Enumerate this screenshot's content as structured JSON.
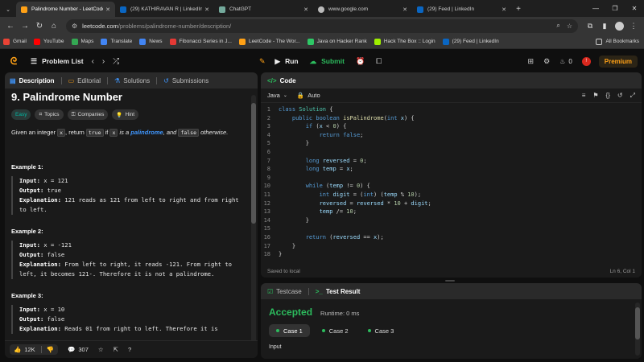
{
  "browser": {
    "tabs": [
      {
        "title": "Palindrome Number - LeetCode",
        "fav": "#ffa116"
      },
      {
        "title": "(29) KATHIRAVAN R | LinkedIn",
        "fav": "#0a66c2"
      },
      {
        "title": "ChatGPT",
        "fav": "#74aa9c"
      },
      {
        "title": "www.google.com",
        "fav": "#cccccc"
      },
      {
        "title": "(29) Feed | LinkedIn",
        "fav": "#0a66c2"
      }
    ],
    "url_host": "leetcode.com",
    "url_path": "/problems/palindrome-number/description/",
    "bookmarks": [
      {
        "label": "Gmail",
        "color": "#ea4335"
      },
      {
        "label": "YouTube",
        "color": "#ff0000"
      },
      {
        "label": "Maps",
        "color": "#34a853"
      },
      {
        "label": "Translate",
        "color": "#4285f4"
      },
      {
        "label": "News",
        "color": "#4285f4"
      },
      {
        "label": "Fibonacci Series in J...",
        "color": "#e53935"
      },
      {
        "label": "LeetCode - The Wor...",
        "color": "#ffa116"
      },
      {
        "label": "Java on Hacker Rank",
        "color": "#2ec866"
      },
      {
        "label": "Hack The Box :: Login",
        "color": "#9fef00"
      },
      {
        "label": "(29) Feed | LinkedIn",
        "color": "#0a66c2"
      }
    ],
    "all_bookmarks": "All Bookmarks"
  },
  "topnav": {
    "problem_list": "Problem List",
    "run": "Run",
    "submit": "Submit",
    "streak": "0",
    "premium": "Premium"
  },
  "left": {
    "tabs": [
      "Description",
      "Editorial",
      "Solutions",
      "Submissions"
    ],
    "title": "9. Palindrome Number",
    "chips": [
      "Easy",
      "Topics",
      "Companies",
      "Hint"
    ],
    "desc": {
      "p1": "Given an integer ",
      "x": "x",
      "p2": ", return ",
      "t": "true",
      "p3": " if ",
      "x2": "x",
      "p4": " is a ",
      "pal": "palindrome",
      "p5": ", and ",
      "f": "false",
      "p6": " otherwise."
    },
    "examples": [
      {
        "head": "Example 1:",
        "input": "x = 121",
        "output": "true",
        "expl": "121 reads as 121 from left to right and from right to left."
      },
      {
        "head": "Example 2:",
        "input": "x = -121",
        "output": "false",
        "expl": "From left to right, it reads -121. From right to left, it becomes 121-. Therefore it is not a palindrome."
      },
      {
        "head": "Example 3:",
        "input": "x = 10",
        "output": "false",
        "expl": "Reads 01 from right to left. Therefore it is"
      }
    ],
    "labels": {
      "input": "Input:",
      "output": "Output:",
      "expl": "Explanation:"
    },
    "likes": "12K",
    "comments": "307"
  },
  "code": {
    "header": "Code",
    "language": "Java",
    "mode": "Auto",
    "saved": "Saved to local",
    "cursor": "Ln 6, Col 1"
  },
  "result": {
    "tabs": [
      "Testcase",
      "Test Result"
    ],
    "status": "Accepted",
    "runtime": "Runtime: 0 ms",
    "cases": [
      "Case 1",
      "Case 2",
      "Case 3"
    ],
    "input_label": "Input"
  }
}
